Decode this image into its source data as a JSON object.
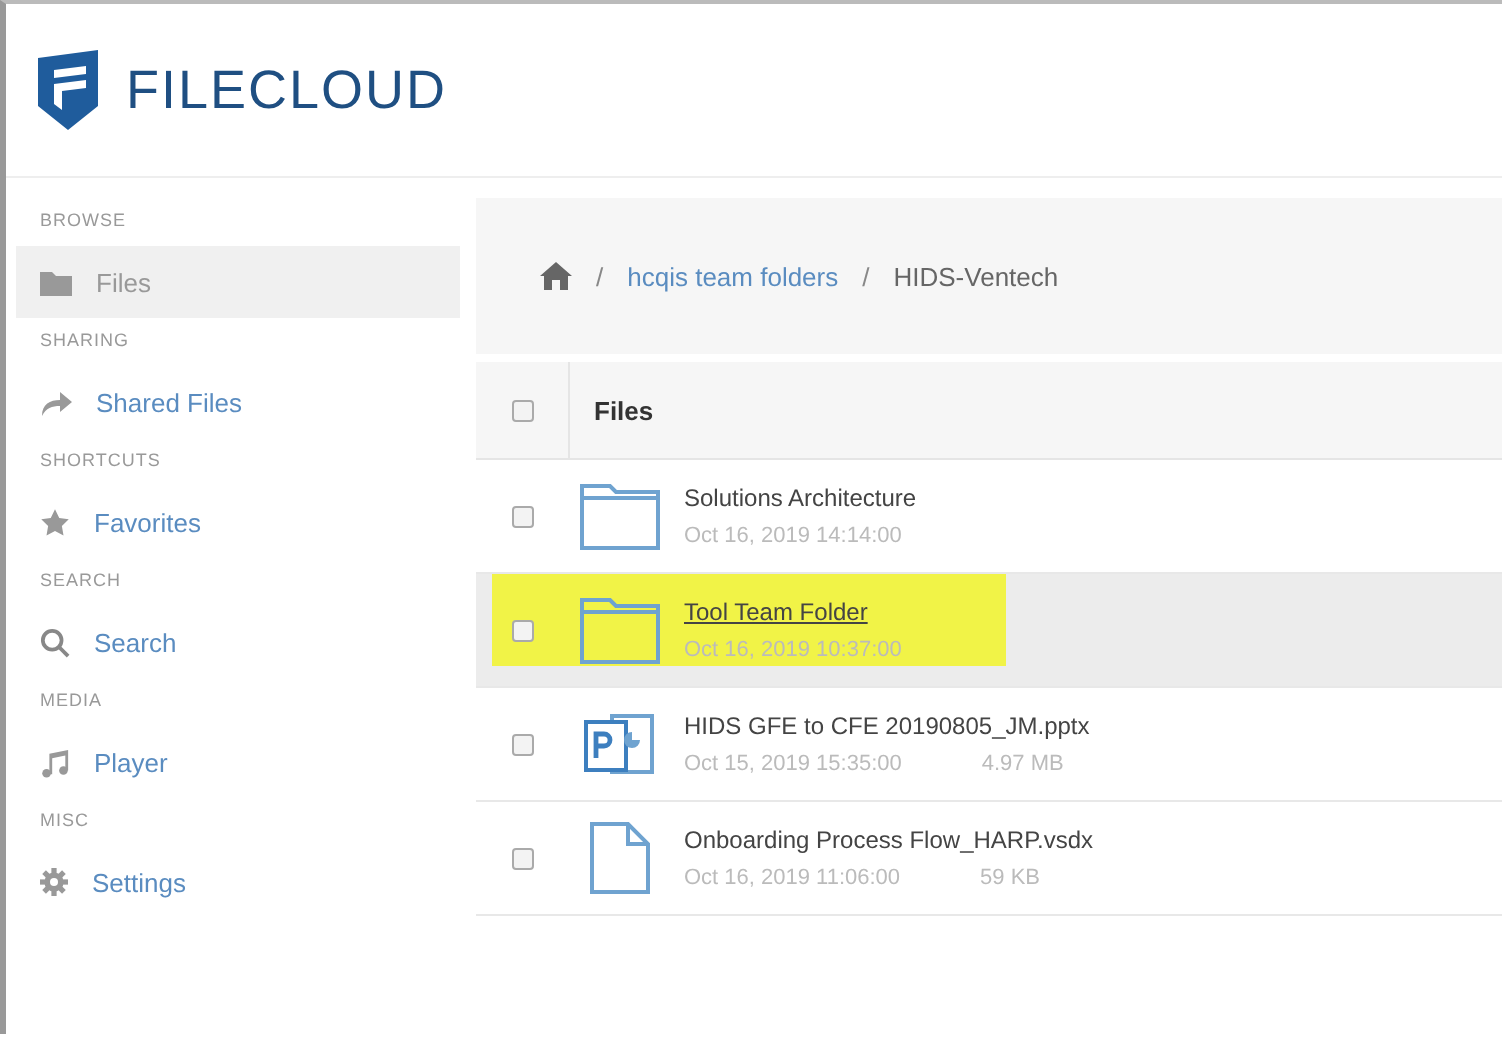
{
  "header": {
    "logo_text": "FILECLOUD"
  },
  "sidebar": {
    "sections": [
      {
        "heading": "BROWSE",
        "items": [
          {
            "label": "Files",
            "selected": true
          }
        ]
      },
      {
        "heading": "SHARING",
        "items": [
          {
            "label": "Shared Files",
            "selected": false
          }
        ]
      },
      {
        "heading": "SHORTCUTS",
        "items": [
          {
            "label": "Favorites",
            "selected": false
          }
        ]
      },
      {
        "heading": "SEARCH",
        "items": [
          {
            "label": "Search",
            "selected": false
          }
        ]
      },
      {
        "heading": "MEDIA",
        "items": [
          {
            "label": "Player",
            "selected": false
          }
        ]
      },
      {
        "heading": "MISC",
        "items": [
          {
            "label": "Settings",
            "selected": false
          }
        ]
      }
    ]
  },
  "breadcrumb": [
    {
      "separator": "/",
      "label": "hcqis team folders",
      "kind": "link"
    },
    {
      "separator": "/",
      "label": "HIDS-Ventech",
      "kind": "current"
    }
  ],
  "table": {
    "header": {
      "label": "Files",
      "checked": false
    },
    "rows": [
      {
        "kind": "folder",
        "name": "Solutions Architecture",
        "date": "Oct 16, 2019 14:14:00",
        "checked": false,
        "selected": false,
        "highlighted": false
      },
      {
        "kind": "folder",
        "name": "Tool Team Folder",
        "date": "Oct 16, 2019 10:37:00",
        "checked": false,
        "selected": true,
        "highlighted": true
      },
      {
        "kind": "pptx",
        "name": "HIDS GFE to CFE 20190805_JM.pptx",
        "date": "Oct 15, 2019 15:35:00",
        "size": "4.97 MB",
        "checked": false,
        "selected": false,
        "highlighted": false
      },
      {
        "kind": "file",
        "name": "Onboarding Process Flow_HARP.vsdx",
        "date": "Oct 16, 2019 11:06:00",
        "size": "59 KB",
        "checked": false,
        "selected": false,
        "highlighted": false
      }
    ]
  }
}
